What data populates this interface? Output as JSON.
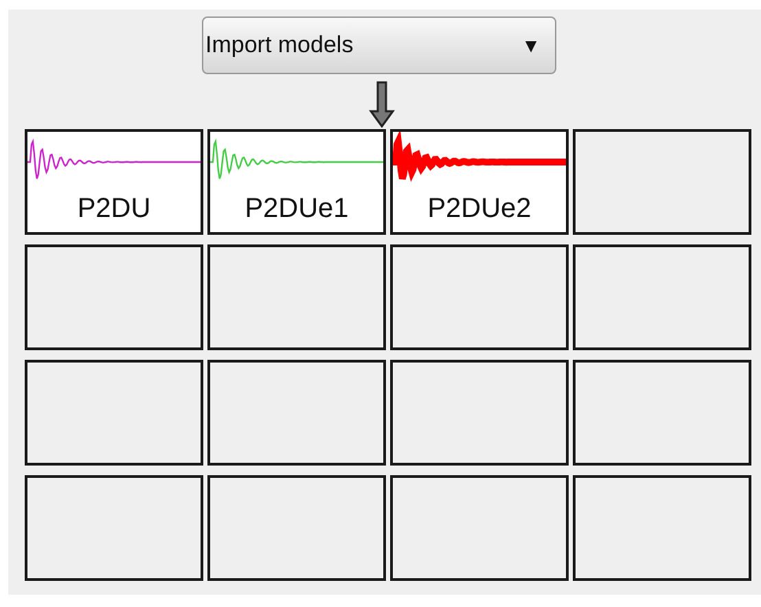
{
  "dropdown": {
    "value": "Import models",
    "arrow": "▼"
  },
  "cells": [
    {
      "kind": "plot",
      "label": "P2DU",
      "color": "#cc22cc",
      "bold": false
    },
    {
      "kind": "plot",
      "label": "P2DUe1",
      "color": "#44cc44",
      "bold": false
    },
    {
      "kind": "plot",
      "label": "P2DUe2",
      "color": "#ff0000",
      "bold": true
    },
    {
      "kind": "empty"
    },
    {
      "kind": "empty"
    },
    {
      "kind": "empty"
    },
    {
      "kind": "empty"
    },
    {
      "kind": "empty"
    },
    {
      "kind": "empty"
    },
    {
      "kind": "empty"
    },
    {
      "kind": "empty"
    },
    {
      "kind": "empty"
    },
    {
      "kind": "empty"
    },
    {
      "kind": "empty"
    },
    {
      "kind": "empty"
    },
    {
      "kind": "empty"
    }
  ]
}
